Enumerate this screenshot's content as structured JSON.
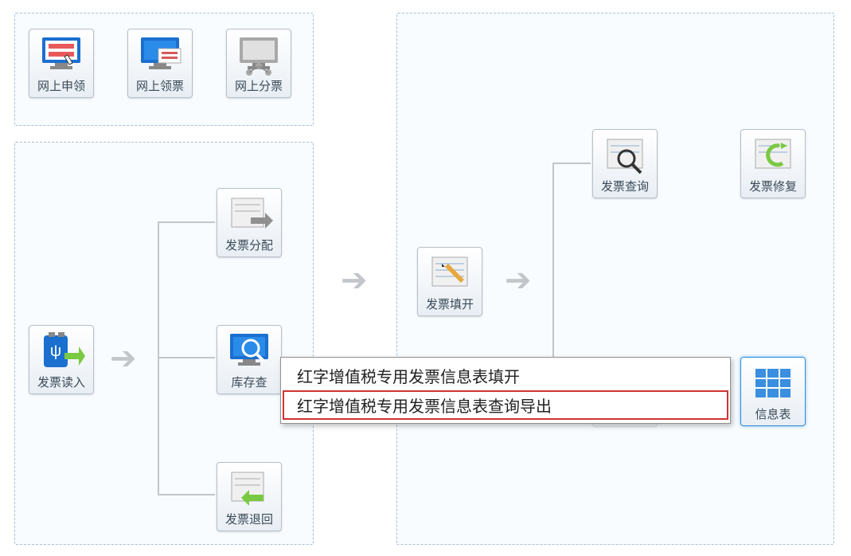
{
  "group1": {
    "items": [
      {
        "label": "网上申领"
      },
      {
        "label": "网上领票"
      },
      {
        "label": "网上分票"
      }
    ]
  },
  "group2": {
    "read": "发票读入",
    "distribute": "发票分配",
    "stockquery": "库存查",
    "return": "发票退回"
  },
  "group3": {
    "fill": "发票填开",
    "query": "发票查询",
    "repair": "发票修复",
    "infotable": "信息表"
  },
  "context_menu": {
    "item1": "红字增值税专用发票信息表填开",
    "item2": "红字增值税专用发票信息表查询导出"
  }
}
